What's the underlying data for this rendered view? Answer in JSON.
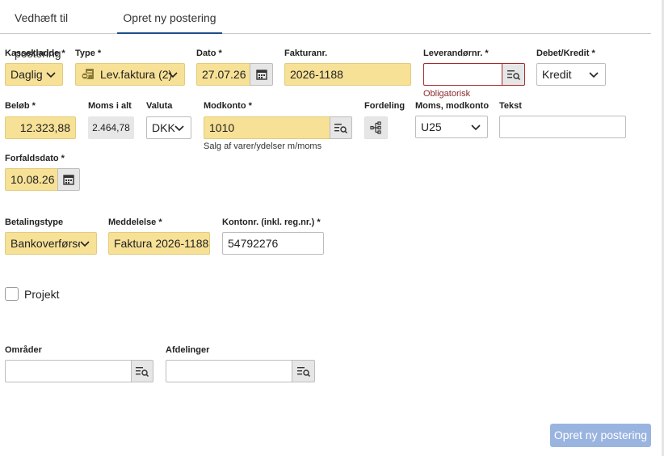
{
  "tabs": [
    {
      "label": "Vedhæft til postering",
      "active": false
    },
    {
      "label": "Opret ny postering",
      "active": true
    }
  ],
  "form": {
    "kassekladde": {
      "label": "Kassekladde *",
      "value": "Daglig"
    },
    "type": {
      "label": "Type *",
      "value": "Lev.faktura (2)",
      "icon": "supplier-invoice-icon"
    },
    "dato": {
      "label": "Dato *",
      "value": "27.07.26"
    },
    "fakturanr": {
      "label": "Fakturanr.",
      "value": "2026-1188"
    },
    "leverandornr": {
      "label": "Leverandørnr. *",
      "value": "",
      "error": "Obligatorisk"
    },
    "debet_kredit": {
      "label": "Debet/Kredit *",
      "value": "Kredit"
    },
    "belob": {
      "label": "Beløb *",
      "value": "12.323,88"
    },
    "moms_i_alt": {
      "label": "Moms i alt",
      "value": "2.464,78"
    },
    "valuta": {
      "label": "Valuta",
      "value": "DKK"
    },
    "modkonto": {
      "label": "Modkonto *",
      "value": "1010",
      "hint": "Salg af varer/ydelser m/moms"
    },
    "fordeling": {
      "label": "Fordeling"
    },
    "moms_modkonto": {
      "label": "Moms, modkonto",
      "value": "U25"
    },
    "tekst": {
      "label": "Tekst",
      "value": ""
    },
    "forfaldsdato": {
      "label": "Forfaldsdato *",
      "value": "10.08.26"
    },
    "betalingstype": {
      "label": "Betalingstype",
      "value": "Bankoverførsel"
    },
    "meddelelse": {
      "label": "Meddelelse *",
      "value": "Faktura 2026-1188"
    },
    "kontonr": {
      "label": "Kontonr. (inkl. reg.nr.) *",
      "value": "54792276"
    },
    "projekt": {
      "label": "Projekt",
      "checked": false
    },
    "omrader": {
      "label": "Områder",
      "value": ""
    },
    "afdelinger": {
      "label": "Afdelinger",
      "value": ""
    }
  },
  "actions": {
    "submit_label": "Opret ny postering"
  },
  "colors": {
    "required_fill": "#f7e196",
    "error": "#a52a2a",
    "primary_disabled": "#9ab4e0",
    "tab_accent": "#1f4d8c"
  }
}
